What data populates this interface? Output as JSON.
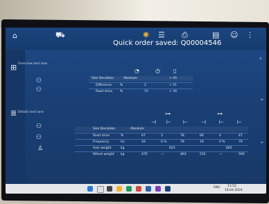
{
  "header": {
    "title": "Quick order saved: Q00004546"
  },
  "section1": {
    "label": "Overview test lane",
    "size_label": "Size Deviation",
    "size_value": "Absolute",
    "rows": [
      {
        "label": "Difference",
        "unit": "%",
        "value": "2",
        "extra": "+ 21"
      },
      {
        "label": "Road drive",
        "unit": "%",
        "value": "15",
        "extra": "+ 34"
      }
    ],
    "top_extra": "+ 45"
  },
  "section2": {
    "label": "Details test lane",
    "size_label": "Size Deviation",
    "size_value": "Absolute",
    "rows": [
      {
        "label": "Road drive",
        "unit": "%",
        "cols": [
          "67",
          "3",
          "78",
          "66",
          "4",
          "47"
        ]
      },
      {
        "label": "Frequency",
        "unit": "Hz",
        "cols": [
          "16",
          "0 %",
          "78",
          "16",
          "0 %",
          "79"
        ]
      },
      {
        "label": "Axle weight",
        "unit": "kg",
        "cols": [
          "",
          "823",
          "",
          "",
          "805",
          ""
        ]
      },
      {
        "label": "Wheel weight",
        "unit": "kg",
        "cols": [
          "470",
          "—",
          "463",
          "510",
          "—",
          "500"
        ]
      }
    ]
  },
  "taskbar": {
    "time": "11:52",
    "date": "19.04.2024",
    "lang": "ENG"
  },
  "colors": {
    "screen_bg": "#1c4680",
    "accent": "#f2b233"
  }
}
